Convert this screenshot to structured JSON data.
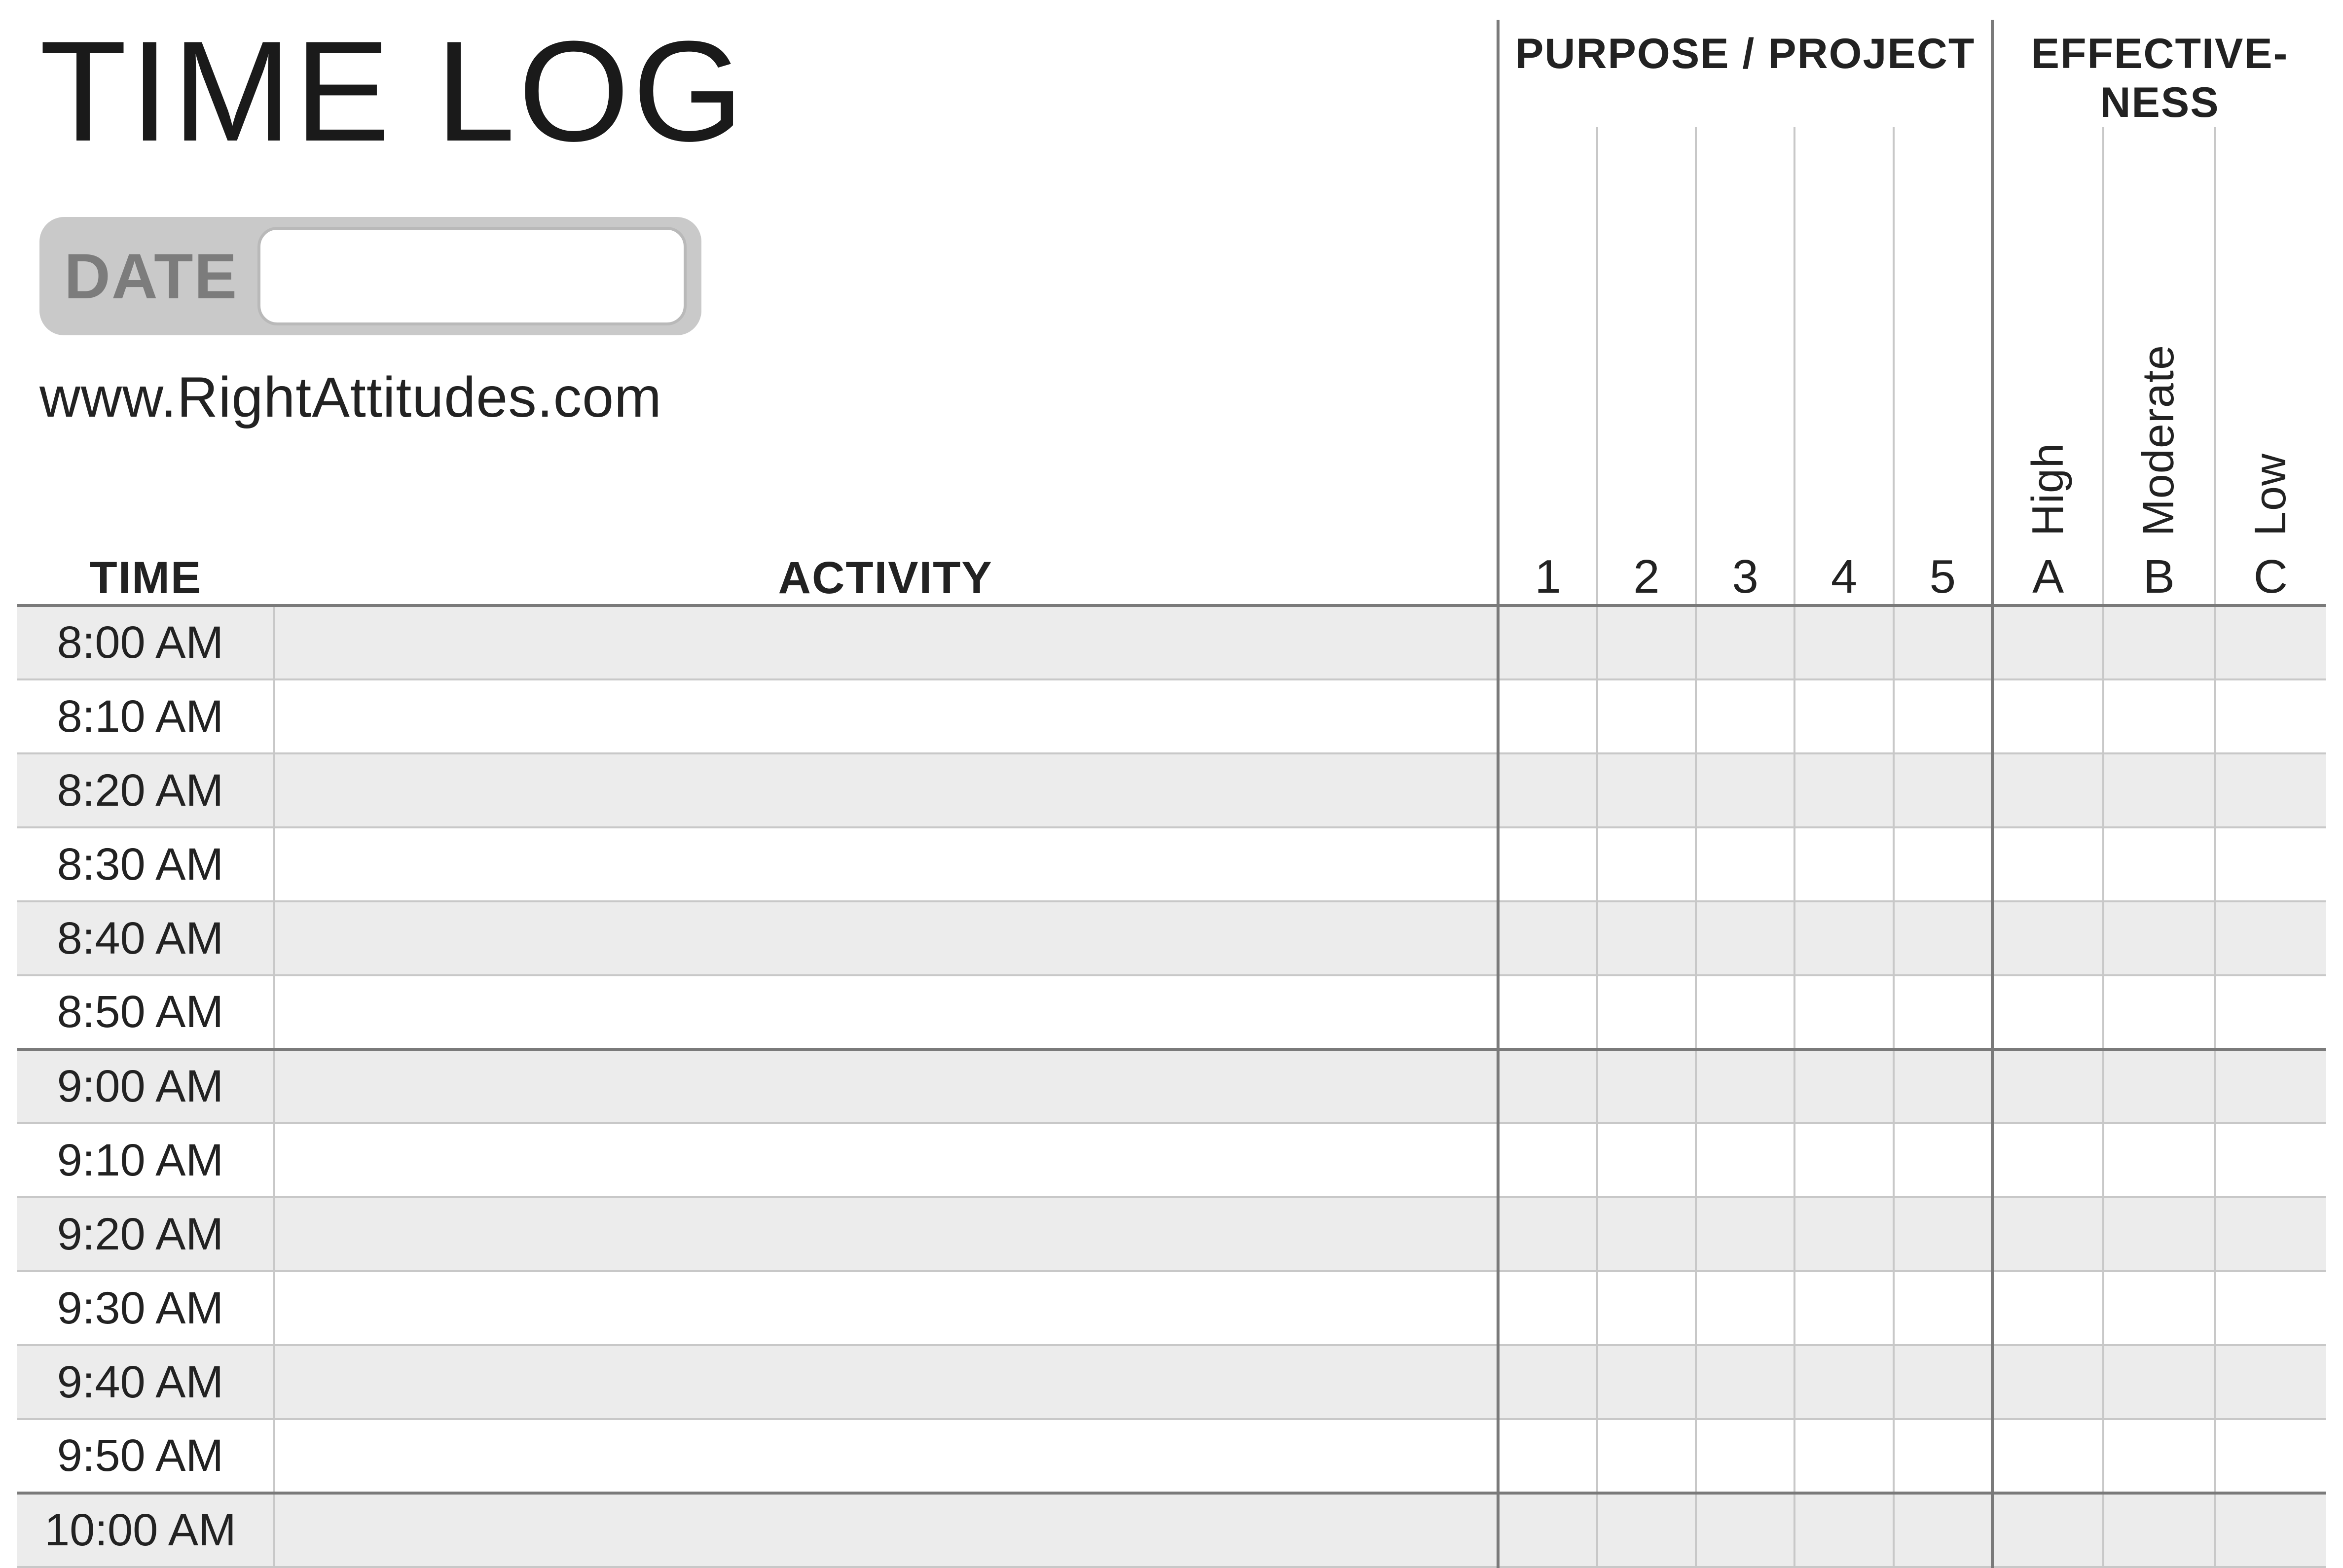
{
  "title": "TIME LOG",
  "date_label": "DATE",
  "date_value": "",
  "source_url": "www.RightAttitudes.com",
  "headers": {
    "time": "TIME",
    "activity": "ACTIVITY",
    "purpose_group": "PURPOSE / PROJECT",
    "effectiveness_group_line1": "EFFECTIVE-",
    "effectiveness_group_line2": "NESS",
    "purpose_numbers": [
      "1",
      "2",
      "3",
      "4",
      "5"
    ],
    "effectiveness_labels": [
      "High",
      "Moderate",
      "Low"
    ],
    "effectiveness_letters": [
      "A",
      "B",
      "C"
    ]
  },
  "rows": [
    {
      "time": "8:00 AM",
      "shade": true,
      "hour_sep": false,
      "first": true
    },
    {
      "time": "8:10 AM",
      "shade": false,
      "hour_sep": false
    },
    {
      "time": "8:20 AM",
      "shade": true,
      "hour_sep": false
    },
    {
      "time": "8:30 AM",
      "shade": false,
      "hour_sep": false
    },
    {
      "time": "8:40 AM",
      "shade": true,
      "hour_sep": false
    },
    {
      "time": "8:50 AM",
      "shade": false,
      "hour_sep": true
    },
    {
      "time": "9:00 AM",
      "shade": true,
      "hour_sep": false
    },
    {
      "time": "9:10 AM",
      "shade": false,
      "hour_sep": false
    },
    {
      "time": "9:20 AM",
      "shade": true,
      "hour_sep": false
    },
    {
      "time": "9:30 AM",
      "shade": false,
      "hour_sep": false
    },
    {
      "time": "9:40 AM",
      "shade": true,
      "hour_sep": false
    },
    {
      "time": "9:50 AM",
      "shade": false,
      "hour_sep": true
    },
    {
      "time": "10:00 AM",
      "shade": true,
      "hour_sep": false
    }
  ]
}
